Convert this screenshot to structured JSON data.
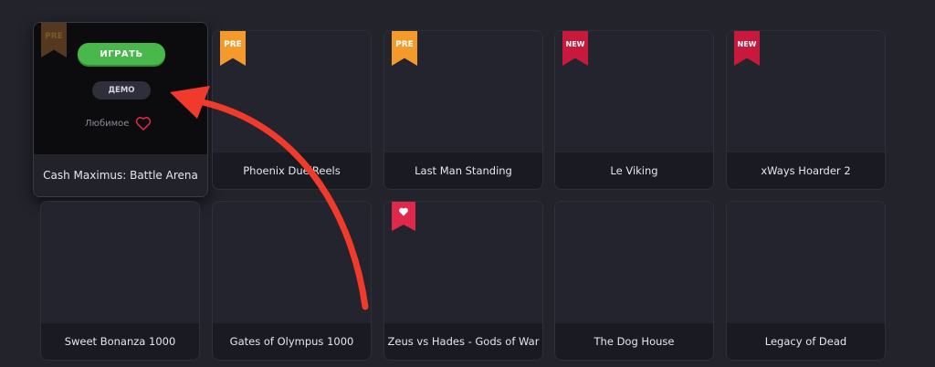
{
  "games": [
    {
      "title": "Cash Maximus: Battle Arena",
      "badge": "PRE"
    },
    {
      "title": "Phoenix DuelReels",
      "badge": "PRE"
    },
    {
      "title": "Last Man Standing",
      "badge": "PRE"
    },
    {
      "title": "Le Viking",
      "badge": "NEW"
    },
    {
      "title": "xWays Hoarder 2",
      "badge": "NEW"
    },
    {
      "title": "Sweet Bonanza 1000",
      "badge": ""
    },
    {
      "title": "Gates of Olympus 1000",
      "badge": ""
    },
    {
      "title": "Zeus vs Hades - Gods of War",
      "badge": "favorite-heart-icon"
    },
    {
      "title": "The Dog House",
      "badge": ""
    },
    {
      "title": "Legacy of Dead",
      "badge": ""
    }
  ],
  "hover_card": {
    "play_label": "ИГРАТЬ",
    "demo_label": "ДЕМО",
    "favorite_label": "Любимое"
  },
  "colors": {
    "background": "#22232b",
    "play_button": "#48b84a",
    "pre_badge": "#f39a2b",
    "new_badge": "#c8193c",
    "annotation_arrow": "#ef3a2c"
  }
}
